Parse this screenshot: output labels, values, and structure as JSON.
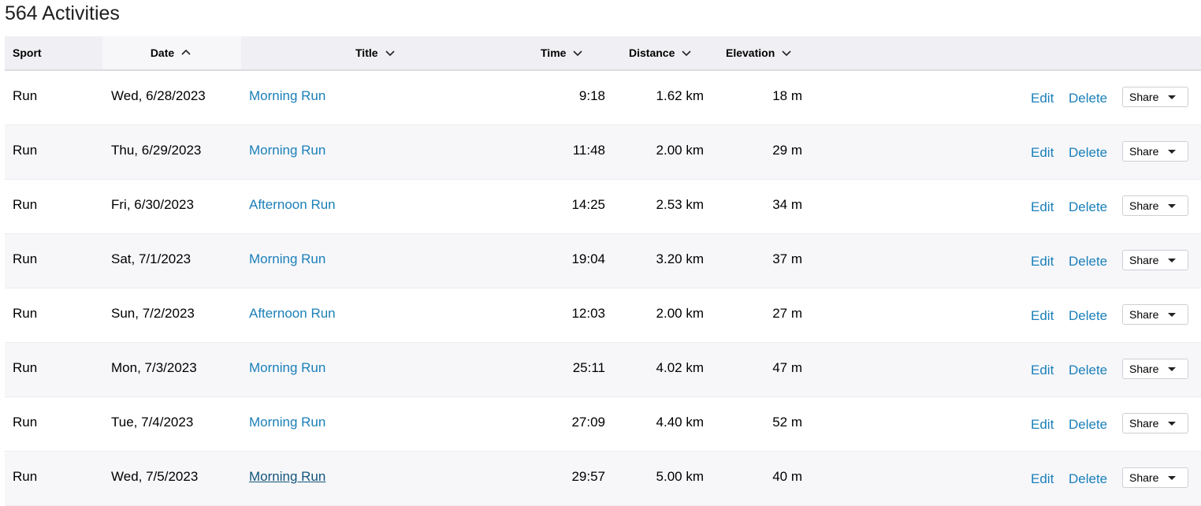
{
  "title": "564 Activities",
  "columns": {
    "sport": "Sport",
    "date": "Date",
    "title": "Title",
    "time": "Time",
    "distance": "Distance",
    "elevation": "Elevation"
  },
  "actions": {
    "edit": "Edit",
    "delete": "Delete",
    "share": "Share"
  },
  "icons": {
    "sort_asc": "chevron-up-icon",
    "sort_desc": "chevron-down-icon",
    "dropdown": "caret-down-icon"
  },
  "colors": {
    "link": "#1a7fb8",
    "header_bg": "#f0f0f4",
    "row_alt_bg": "#f7f7fa"
  },
  "rows": [
    {
      "sport": "Run",
      "date": "Wed, 6/28/2023",
      "title": "Morning Run",
      "time": "9:18",
      "distance": "1.62 km",
      "elevation": "18 m"
    },
    {
      "sport": "Run",
      "date": "Thu, 6/29/2023",
      "title": "Morning Run",
      "time": "11:48",
      "distance": "2.00 km",
      "elevation": "29 m"
    },
    {
      "sport": "Run",
      "date": "Fri, 6/30/2023",
      "title": "Afternoon Run",
      "time": "14:25",
      "distance": "2.53 km",
      "elevation": "34 m"
    },
    {
      "sport": "Run",
      "date": "Sat, 7/1/2023",
      "title": "Morning Run",
      "time": "19:04",
      "distance": "3.20 km",
      "elevation": "37 m"
    },
    {
      "sport": "Run",
      "date": "Sun, 7/2/2023",
      "title": "Afternoon Run",
      "time": "12:03",
      "distance": "2.00 km",
      "elevation": "27 m"
    },
    {
      "sport": "Run",
      "date": "Mon, 7/3/2023",
      "title": "Morning Run",
      "time": "25:11",
      "distance": "4.02 km",
      "elevation": "47 m"
    },
    {
      "sport": "Run",
      "date": "Tue, 7/4/2023",
      "title": "Morning Run",
      "time": "27:09",
      "distance": "4.40 km",
      "elevation": "52 m"
    },
    {
      "sport": "Run",
      "date": "Wed, 7/5/2023",
      "title": "Morning Run",
      "time": "29:57",
      "distance": "5.00 km",
      "elevation": "40 m"
    }
  ]
}
